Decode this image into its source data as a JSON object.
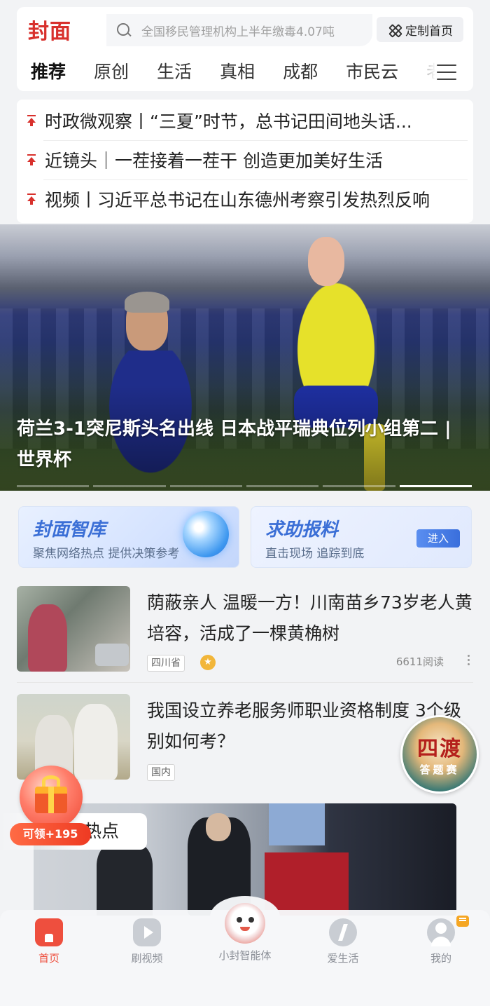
{
  "header": {
    "logo_text": "封面",
    "search_placeholder": "全国移民管理机构上半年缴毒4.07吨",
    "custom_home_label": "定制首页"
  },
  "tabs": [
    "推荐",
    "原创",
    "生活",
    "真相",
    "成都",
    "市民云",
    "老"
  ],
  "active_tab": "推荐",
  "pinned_headlines": [
    "时政微观察丨“三夏”时节，总书记田间地头话...",
    "近镜头｜一茬接着一茬干 创造更加美好生活",
    "视频丨习近平总书记在山东德州考察引发热烈反响"
  ],
  "hero": {
    "caption": "荷兰3-1突尼斯头名出线 日本战平瑞典位列小组第二 | 世界杯",
    "slide_count": 6,
    "active_slide": 5
  },
  "features": [
    {
      "title": "封面智库",
      "subtitle": "聚焦网络热点  提供决策参考"
    },
    {
      "title": "求助报料",
      "subtitle": "直击现场  追踪到底",
      "button": "进入"
    }
  ],
  "news": [
    {
      "title": "荫蔽亲人  温暖一方！川南苗乡73岁老人黄培容，活成了一棵黄桷树",
      "tag": "四川省",
      "reads": "6611阅读",
      "starred": true
    },
    {
      "title": "我国设立养老服务师职业资格制度 3个级别如何考？",
      "tag": "国内"
    }
  ],
  "video_section": {
    "label": "热点"
  },
  "floating": {
    "gift_label": "可领+195",
    "quiz_title": "四渡",
    "quiz_sub": "答题赛"
  },
  "bottom_nav": [
    {
      "label": "首页",
      "icon": "home-icon",
      "active": true
    },
    {
      "label": "刷视频",
      "icon": "video-play-icon",
      "active": false
    },
    {
      "label": "小封智能体",
      "icon": "robot-mascot-icon",
      "active": false
    },
    {
      "label": "爱生活",
      "icon": "lightning-icon",
      "active": false
    },
    {
      "label": "我的",
      "icon": "user-icon",
      "active": false
    }
  ],
  "colors": {
    "brand_red": "#d8302c",
    "nav_active": "#ee4f3e",
    "feature_blue": "#3b6fd6"
  }
}
